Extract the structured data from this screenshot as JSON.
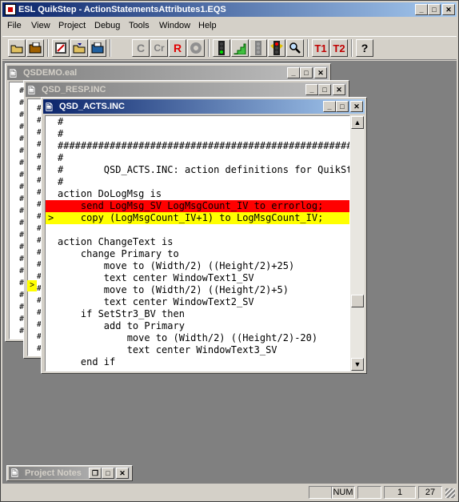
{
  "app": {
    "title": "ESL QuikStep - ActionStatementsAttributes1.EQS",
    "icon": "esl-app-icon"
  },
  "menu": [
    "File",
    "View",
    "Project",
    "Debug",
    "Tools",
    "Window",
    "Help"
  ],
  "toolbar": {
    "icons": [
      "open-folder-icon",
      "close-folder-icon",
      "compile-icon",
      "open-project-icon",
      "save-project-icon",
      "c-icon",
      "c-r-icon",
      "r-icon",
      "stop-gear-icon",
      "traffic-light-green-icon",
      "step-stairs-icon",
      "traffic-light-gray-icon",
      "traffic-light-red-icon",
      "magnifier-icon",
      "t1-icon",
      "t2-icon",
      "help-icon"
    ],
    "labels": {
      "c": "C",
      "cr": "Cr",
      "r": "R",
      "t1": "T1",
      "t2": "T2",
      "help": "?"
    }
  },
  "windows": {
    "demo": {
      "title": "QSDEMO.eal"
    },
    "resp": {
      "title": "QSD_RESP.INC"
    },
    "acts": {
      "title": "QSD_ACTS.INC",
      "lines": [
        {
          "text": "#",
          "style": "normal",
          "marker": ""
        },
        {
          "text": "#",
          "style": "normal",
          "marker": ""
        },
        {
          "text": "##########################################################",
          "style": "normal",
          "marker": ""
        },
        {
          "text": "#",
          "style": "normal",
          "marker": ""
        },
        {
          "text": "#       QSD_ACTS.INC: action definitions for QuikStep demo",
          "style": "normal",
          "marker": ""
        },
        {
          "text": "#",
          "style": "normal",
          "marker": ""
        },
        {
          "text": "action DoLogMsg is",
          "style": "normal",
          "marker": ""
        },
        {
          "text": "    send LogMsg_SV LogMsgCount_IV to errorlog;",
          "style": "red",
          "marker": ""
        },
        {
          "text": "    copy (LogMsgCount_IV+1) to LogMsgCount_IV;",
          "style": "yellow",
          "marker": ">"
        },
        {
          "text": "",
          "style": "normal",
          "marker": ""
        },
        {
          "text": "action ChangeText is",
          "style": "normal",
          "marker": ""
        },
        {
          "text": "    change Primary to",
          "style": "normal",
          "marker": ""
        },
        {
          "text": "        move to (Width/2) ((Height/2)+25)",
          "style": "normal",
          "marker": ""
        },
        {
          "text": "        text center WindowText1_SV",
          "style": "normal",
          "marker": ""
        },
        {
          "text": "        move to (Width/2) ((Height/2)+5)",
          "style": "normal",
          "marker": ""
        },
        {
          "text": "        text center WindowText2_SV",
          "style": "normal",
          "marker": ""
        },
        {
          "text": "    if SetStr3_BV then",
          "style": "normal",
          "marker": ""
        },
        {
          "text": "        add to Primary",
          "style": "normal",
          "marker": ""
        },
        {
          "text": "            move to (Width/2) ((Height/2)-20)",
          "style": "normal",
          "marker": ""
        },
        {
          "text": "            text center WindowText3_SV",
          "style": "normal",
          "marker": ""
        },
        {
          "text": "    end if",
          "style": "normal",
          "marker": ""
        }
      ]
    },
    "notes": {
      "title": "Project Notes"
    }
  },
  "status": {
    "num": "NUM",
    "line": "1",
    "col": "27"
  },
  "colors": {
    "title_active": "#0a246a",
    "breakpoint": "#ff0000",
    "current_line": "#ffff00"
  }
}
